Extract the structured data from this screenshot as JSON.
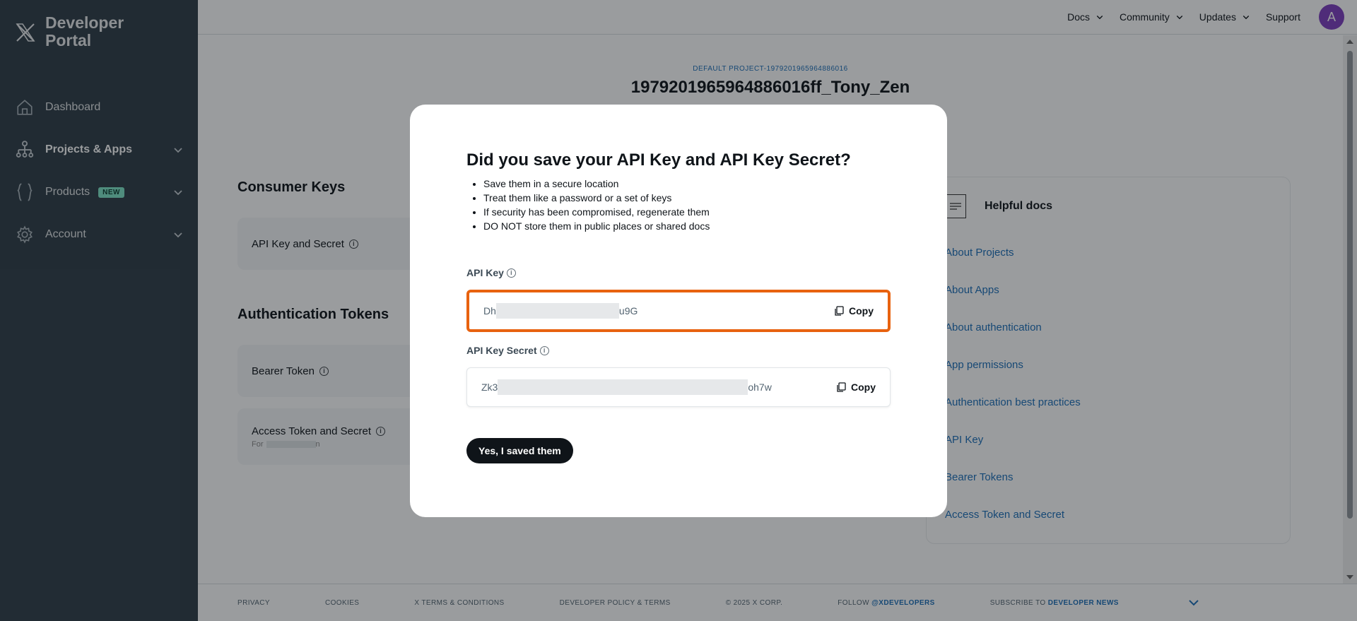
{
  "brand": {
    "line1": "Developer",
    "line2": "Portal"
  },
  "sidebar": {
    "items": [
      {
        "label": "Dashboard",
        "icon": "home-icon"
      },
      {
        "label": "Projects & Apps",
        "icon": "projects-icon",
        "expandable": true
      },
      {
        "label": "Products",
        "icon": "braces-icon",
        "badge": "NEW",
        "expandable": true
      },
      {
        "label": "Account",
        "icon": "gear-icon",
        "expandable": true
      }
    ]
  },
  "topnav": {
    "items": [
      "Docs",
      "Community",
      "Updates",
      "Support"
    ],
    "avatar_initial": "A"
  },
  "project": {
    "kicker": "DEFAULT PROJECT-1979201965964886016",
    "title": "1979201965964886016ff_Tony_Zen"
  },
  "sections": {
    "consumer_keys": "Consumer Keys",
    "api_key_and_secret": "API Key and Secret",
    "auth_tokens": "Authentication Tokens",
    "bearer_token": "Bearer Token",
    "access_token": "Access Token and Secret",
    "access_token_sub_prefix": "For",
    "access_token_sub_suffix": "n"
  },
  "helpful_docs": {
    "title": "Helpful docs",
    "links": [
      "About Projects",
      "About Apps",
      "About authentication",
      "App permissions",
      "Authentication best practices",
      "API Key",
      "Bearer Tokens",
      "Access Token and Secret"
    ]
  },
  "footer": {
    "privacy": "PRIVACY",
    "cookies": "COOKIES",
    "terms": "X TERMS & CONDITIONS",
    "dev_policy": "DEVELOPER POLICY & TERMS",
    "copyright": "© 2025 X CORP.",
    "follow_prefix": "FOLLOW",
    "follow_handle": "@XDEVELOPERS",
    "subscribe_prefix": "SUBSCRIBE TO",
    "subscribe_link": "DEVELOPER NEWS"
  },
  "modal": {
    "title": "Did you save your API Key and API Key Secret?",
    "bullets": [
      "Save them in a secure location",
      "Treat them like a password or a set of keys",
      "If security has been compromised, regenerate them",
      "DO NOT store them in public places or shared docs"
    ],
    "api_key_label": "API Key",
    "api_key_prefix": "Dh",
    "api_key_suffix": "u9G",
    "api_secret_label": "API Key Secret",
    "api_secret_prefix": "Zk3",
    "api_secret_suffix": "oh7w",
    "copy_label": "Copy",
    "confirm_button": "Yes, I saved them"
  },
  "colors": {
    "sidebar_bg": "#2f3d47",
    "highlight_border": "#e8620f",
    "link_blue": "#1d6fb8",
    "avatar_bg": "#7f3fbf",
    "new_badge": "#7fe3c7"
  }
}
